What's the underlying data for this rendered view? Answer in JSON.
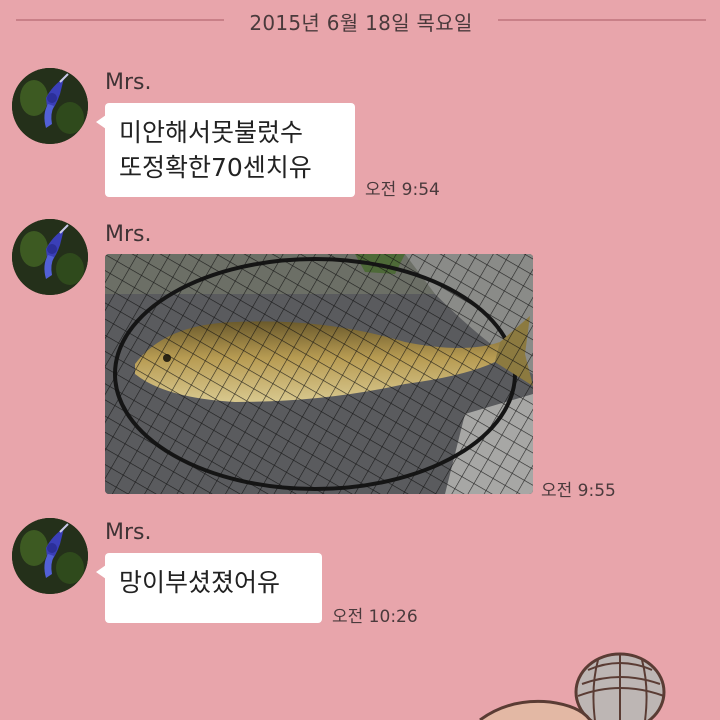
{
  "date_separator": "2015년 6월 18일 목요일",
  "messages": [
    {
      "sender": "Mrs.",
      "type": "text",
      "lines": [
        "미안해서못불렀수",
        "또정확한70센치유"
      ],
      "time": "오전 9:54"
    },
    {
      "sender": "Mrs.",
      "type": "image",
      "image_desc": "fish-photo",
      "time": "오전 9:55"
    },
    {
      "sender": "Mrs.",
      "type": "text",
      "lines": [
        "망이부셨졌어유"
      ],
      "time": "오전 10:26"
    }
  ],
  "colors": {
    "background": "#e8a5ab",
    "bubble": "#ffffff",
    "separator_line": "#c98088"
  }
}
